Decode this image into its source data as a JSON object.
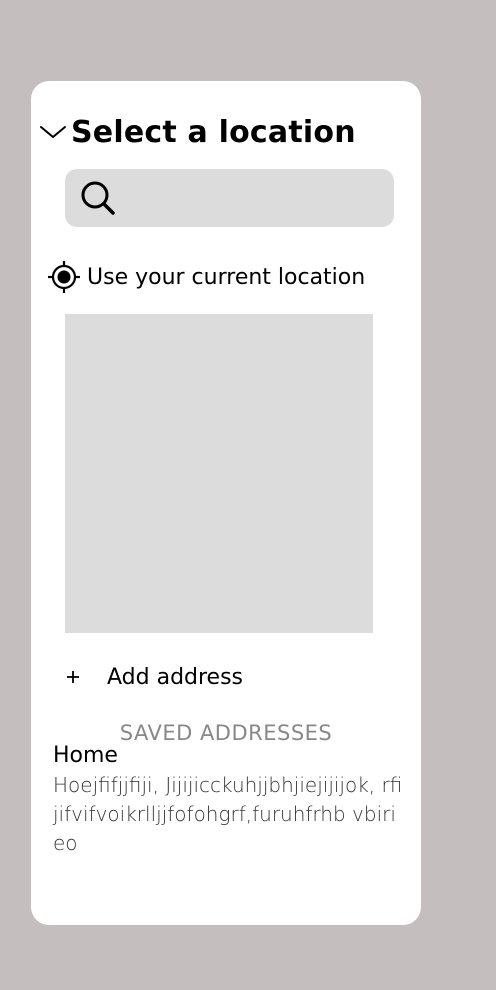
{
  "header": {
    "title": "Select a location"
  },
  "search": {
    "value": "",
    "placeholder": ""
  },
  "current_location": {
    "label": "Use your current location"
  },
  "add_address": {
    "icon": "+",
    "label": "Add address"
  },
  "saved": {
    "heading": "SAVED ADDRESSES",
    "items": [
      {
        "name": "Home",
        "address": "Hoejfifjjfiji, Jijijicckuhjjbhjiejijijok, rfijifvifvoikrlljjfofohgrf,furuhfrhb vbirieo"
      }
    ]
  },
  "colors": {
    "background": "#c4bfbe",
    "panel": "#ffffff",
    "field": "#dcdcdc",
    "text": "#000000",
    "muted": "#888888"
  }
}
